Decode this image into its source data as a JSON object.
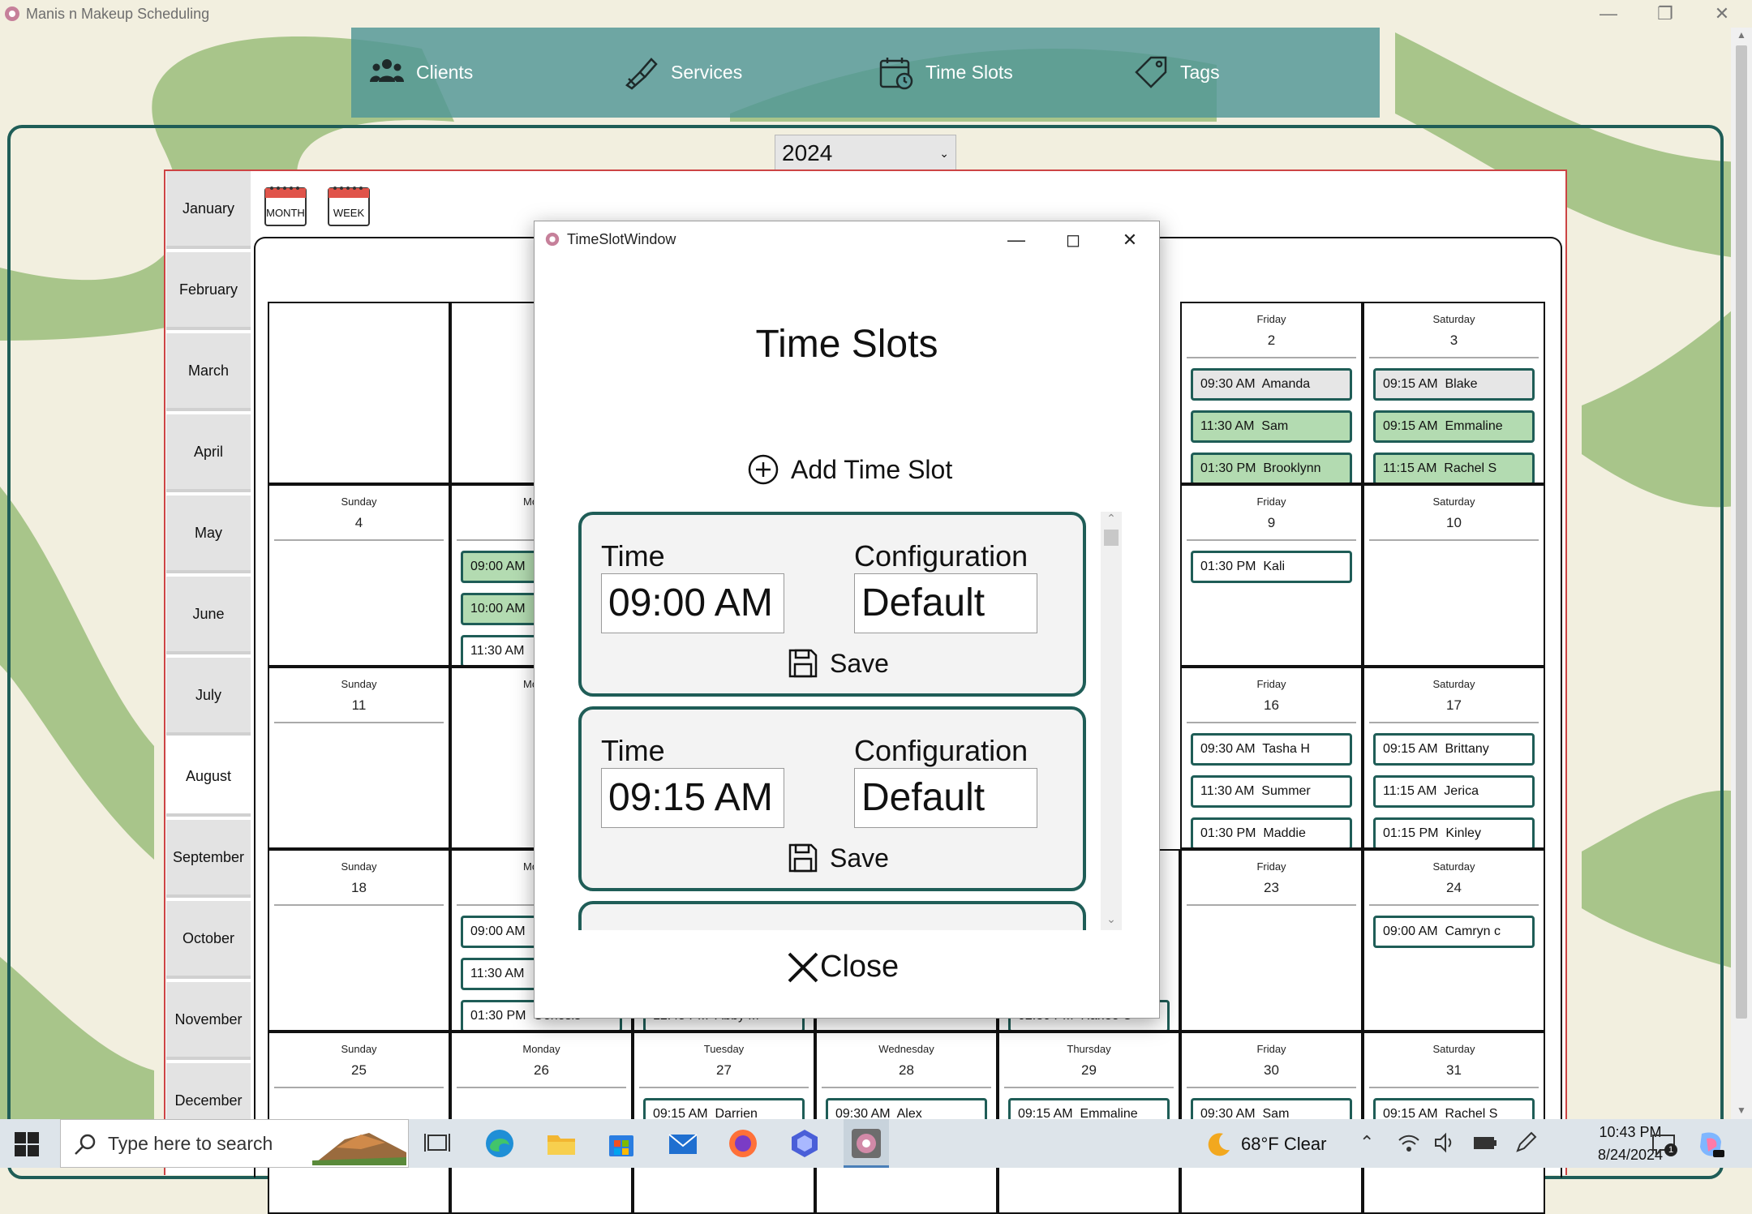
{
  "app": {
    "title": "Manis n Makeup Scheduling"
  },
  "nav": [
    {
      "label": "Clients",
      "icon": "people-icon"
    },
    {
      "label": "Services",
      "icon": "nail-polish-icon"
    },
    {
      "label": "Time Slots",
      "icon": "calendar-clock-icon"
    },
    {
      "label": "Tags",
      "icon": "tag-icon"
    }
  ],
  "year": {
    "selected": "2024"
  },
  "months": [
    "January",
    "February",
    "March",
    "April",
    "May",
    "June",
    "July",
    "August",
    "September",
    "October",
    "November",
    "December"
  ],
  "active_month": "August",
  "view_buttons": {
    "month": "MONTH",
    "week": "WEEK"
  },
  "calendar": {
    "week1": {
      "fri": {
        "day": "Friday",
        "num": "2",
        "appts": [
          [
            "09:30 AM  Amanda",
            "gry"
          ],
          [
            "11:30 AM  Sam",
            "grn"
          ],
          [
            "01:30 PM  Brooklynn",
            "grn"
          ]
        ]
      },
      "sat": {
        "day": "Saturday",
        "num": "3",
        "appts": [
          [
            "09:15 AM  Blake",
            "gry"
          ],
          [
            "09:15 AM  Emmaline",
            "grn"
          ],
          [
            "11:15 AM  Rachel S",
            "grn"
          ]
        ]
      }
    },
    "week2": {
      "sun": {
        "day": "Sunday",
        "num": "4"
      },
      "mon": {
        "day": "Mo",
        "appts": [
          [
            "09:00 AM",
            "grn"
          ],
          [
            "10:00 AM",
            "grn"
          ],
          [
            "11:30 AM",
            ""
          ]
        ]
      },
      "fri": {
        "day": "Friday",
        "num": "9",
        "appts": [
          [
            "01:30 PM  Kali",
            ""
          ]
        ]
      },
      "sat": {
        "day": "Saturday",
        "num": "10"
      }
    },
    "week3": {
      "sun": {
        "day": "Sunday",
        "num": "11"
      },
      "mon": {
        "day": "Mo"
      },
      "fri": {
        "day": "Friday",
        "num": "16",
        "appts": [
          [
            "09:30 AM  Tasha H",
            ""
          ],
          [
            "11:30 AM  Summer",
            ""
          ],
          [
            "01:30 PM  Maddie",
            ""
          ]
        ]
      },
      "sat": {
        "day": "Saturday",
        "num": "17",
        "appts": [
          [
            "09:15 AM  Brittany",
            ""
          ],
          [
            "11:15 AM  Jerica",
            ""
          ],
          [
            "01:15 PM  Kinley",
            ""
          ]
        ]
      }
    },
    "week4": {
      "sun": {
        "day": "Sunday",
        "num": "18"
      },
      "mon": {
        "day": "Mo",
        "appts": [
          [
            "09:00 AM",
            ""
          ],
          [
            "11:30 AM",
            ""
          ],
          [
            "01:30 PM  Genesis",
            ""
          ]
        ]
      },
      "tue_partial": "12:45 PM  Abby M",
      "thu_partial": "02:30 PM  Harlee C",
      "fri": {
        "day": "Friday",
        "num": "23"
      },
      "sat": {
        "day": "Saturday",
        "num": "24",
        "appts": [
          [
            "09:00 AM  Camryn c",
            ""
          ]
        ]
      }
    },
    "week5": [
      {
        "day": "Sunday",
        "num": "25",
        "appt": ""
      },
      {
        "day": "Monday",
        "num": "26",
        "appt": ""
      },
      {
        "day": "Tuesday",
        "num": "27",
        "appt": "09:15 AM  Darrien"
      },
      {
        "day": "Wednesday",
        "num": "28",
        "appt": "09:30 AM  Alex"
      },
      {
        "day": "Thursday",
        "num": "29",
        "appt": "09:15 AM  Emmaline"
      },
      {
        "day": "Friday",
        "num": "30",
        "appt": "09:30 AM  Sam"
      },
      {
        "day": "Saturday",
        "num": "31",
        "appt": "09:15 AM  Rachel S"
      }
    ]
  },
  "dialog": {
    "window_title": "TimeSlotWindow",
    "heading": "Time Slots",
    "add_label": "Add Time Slot",
    "close_label": "Close",
    "time_label": "Time",
    "config_label": "Configuration",
    "save_label": "Save",
    "slots": [
      {
        "time": "09:00 AM",
        "config": "Default"
      },
      {
        "time": "09:15 AM",
        "config": "Default"
      }
    ]
  },
  "taskbar": {
    "search_placeholder": "Type here to search",
    "weather": "68°F  Clear",
    "time": "10:43 PM",
    "date": "8/24/2024",
    "notification_count": "1"
  },
  "colors": {
    "accent": "#1f5d57",
    "nav_bg": "#5a9c9a",
    "green_appt": "#b3dbb1",
    "swirl": "#a8c58a"
  }
}
